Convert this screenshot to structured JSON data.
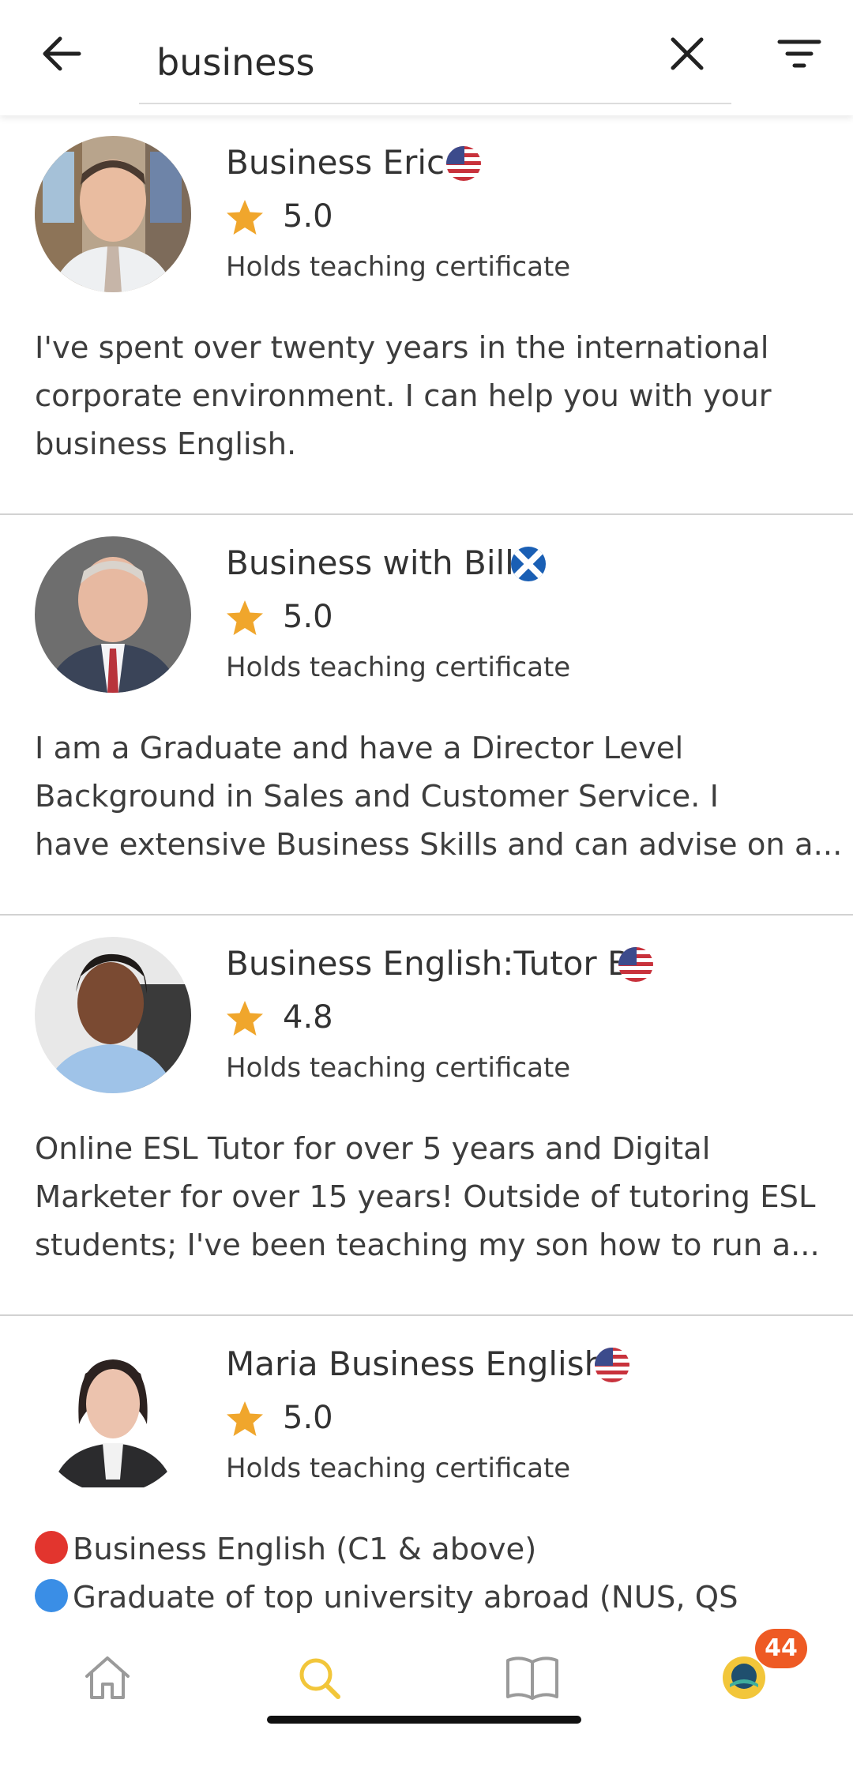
{
  "search": {
    "value": "business",
    "back_icon": "arrow-left-icon",
    "clear_icon": "close-icon",
    "filter_icon": "filter-icon"
  },
  "tutors": [
    {
      "name": "Business Eric",
      "flag": "us-flag-icon",
      "rating": "5.0",
      "certificate": "Holds teaching certificate",
      "bio_lines": [
        "I've spent over twenty years in the international",
        "corporate environment.  I can help you with your",
        "business English."
      ]
    },
    {
      "name": "Business with Bill",
      "flag": "scotland-flag-icon",
      "rating": "5.0",
      "certificate": "Holds teaching certificate",
      "bio_lines": [
        "I am a Graduate and have a Director Level",
        "Background in Sales and Customer Service. I",
        "have extensive Business Skills and can advise on a..."
      ]
    },
    {
      "name": "Business English:Tutor B",
      "flag": "us-flag-icon",
      "rating": "4.8",
      "certificate": "Holds teaching certificate",
      "bio_lines": [
        "Online ESL Tutor for over 5 years and Digital",
        "Marketer for over 15 years! Outside of tutoring ESL",
        "students; I've been teaching my son how to run a..."
      ]
    },
    {
      "name": "Maria Business English",
      "flag": "us-flag-icon",
      "rating": "5.0",
      "certificate": "Holds teaching certificate",
      "bio_lines": [
        "Business English (C1 & above)",
        "Graduate of top university abroad (NUS, QS"
      ],
      "bio_bullets": [
        "red-circle-icon",
        "blue-circle-icon"
      ]
    }
  ],
  "bottom_nav": {
    "items": [
      {
        "icon": "home-icon",
        "active": false
      },
      {
        "icon": "search-icon",
        "active": true
      },
      {
        "icon": "book-icon",
        "active": false
      },
      {
        "icon": "profile-icon",
        "active": false
      }
    ],
    "notification_count": "44"
  },
  "colors": {
    "active_nav": "#f2c63a",
    "inactive_nav": "#9a9a9a",
    "star": "#f0a62c",
    "badge": "#ee5a24",
    "divider": "#d2d2d2"
  }
}
